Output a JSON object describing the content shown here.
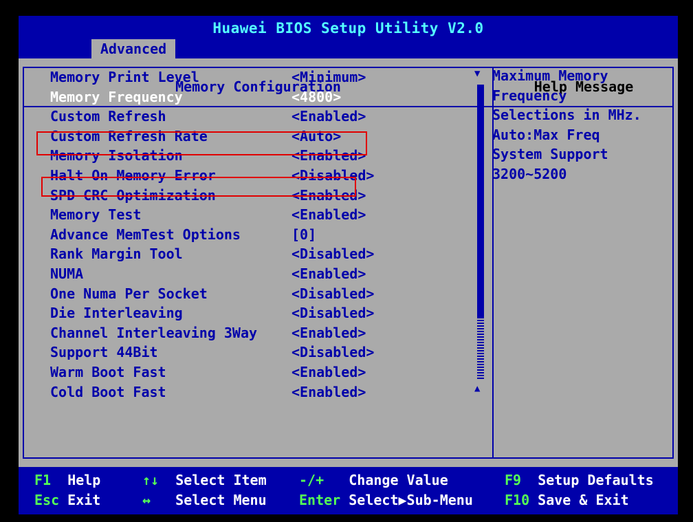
{
  "header": {
    "title": "Huawei BIOS Setup Utility V2.0",
    "active_tab": "Advanced"
  },
  "panel": {
    "left_title": "Memory Configuration",
    "right_title": "Help Message"
  },
  "menu": {
    "items": [
      {
        "label": "Memory Print Level",
        "value": "<Minimum>"
      },
      {
        "label": "Memory Frequency",
        "value": "<4800>"
      },
      {
        "label": "Custom Refresh",
        "value": "<Enabled>"
      },
      {
        "label": "Custom Refresh Rate",
        "value": "<Auto>"
      },
      {
        "label": "Memory Isolation",
        "value": "<Enabled>"
      },
      {
        "label": "Halt On Memory Error",
        "value": "<Disabled>"
      },
      {
        "label": "SPD CRC Optimization",
        "value": "<Enabled>"
      },
      {
        "label": "Memory Test",
        "value": "<Enabled>"
      },
      {
        "label": "Advance MemTest Options",
        "value": "[0]"
      },
      {
        "label": "Rank Margin Tool",
        "value": "<Disabled>"
      },
      {
        "label": "NUMA",
        "value": "<Enabled>"
      },
      {
        "label": "One Numa Per Socket",
        "value": "<Disabled>"
      },
      {
        "label": "Die Interleaving",
        "value": "<Disabled>"
      },
      {
        "label": "Channel Interleaving 3Way",
        "value": "<Enabled>"
      },
      {
        "label": "Support 44Bit",
        "value": "<Disabled>"
      },
      {
        "label": "Warm Boot Fast",
        "value": "<Enabled>"
      },
      {
        "label": "Cold Boot Fast",
        "value": "<Enabled>"
      }
    ]
  },
  "help": {
    "lines": [
      "Maximum Memory",
      "Frequency",
      "Selections in MHz.",
      "Auto:Max Freq",
      "System Support",
      "3200~5200"
    ]
  },
  "footer": {
    "keys": [
      {
        "key": "F1",
        "desc": "Help"
      },
      {
        "key": "Esc",
        "desc": "Exit"
      },
      {
        "key": "↑↓",
        "desc": "Select Item"
      },
      {
        "key": "↔",
        "desc": "Select Menu"
      },
      {
        "key": "-/+",
        "desc": "Change Value"
      },
      {
        "key": "Enter",
        "desc": "Select▶Sub-Menu"
      },
      {
        "key": "F9",
        "desc": "Setup Defaults"
      },
      {
        "key": "F10",
        "desc": "Save & Exit"
      }
    ]
  },
  "scrollbar": {
    "up_arrow": "▼",
    "down_arrow": "▲"
  },
  "colors": {
    "bios_blue": "#0000aa",
    "bios_gray": "#aaaaaa",
    "title_cyan": "#55ffff",
    "key_green": "#55ff55",
    "annotation_red": "#e00000"
  }
}
